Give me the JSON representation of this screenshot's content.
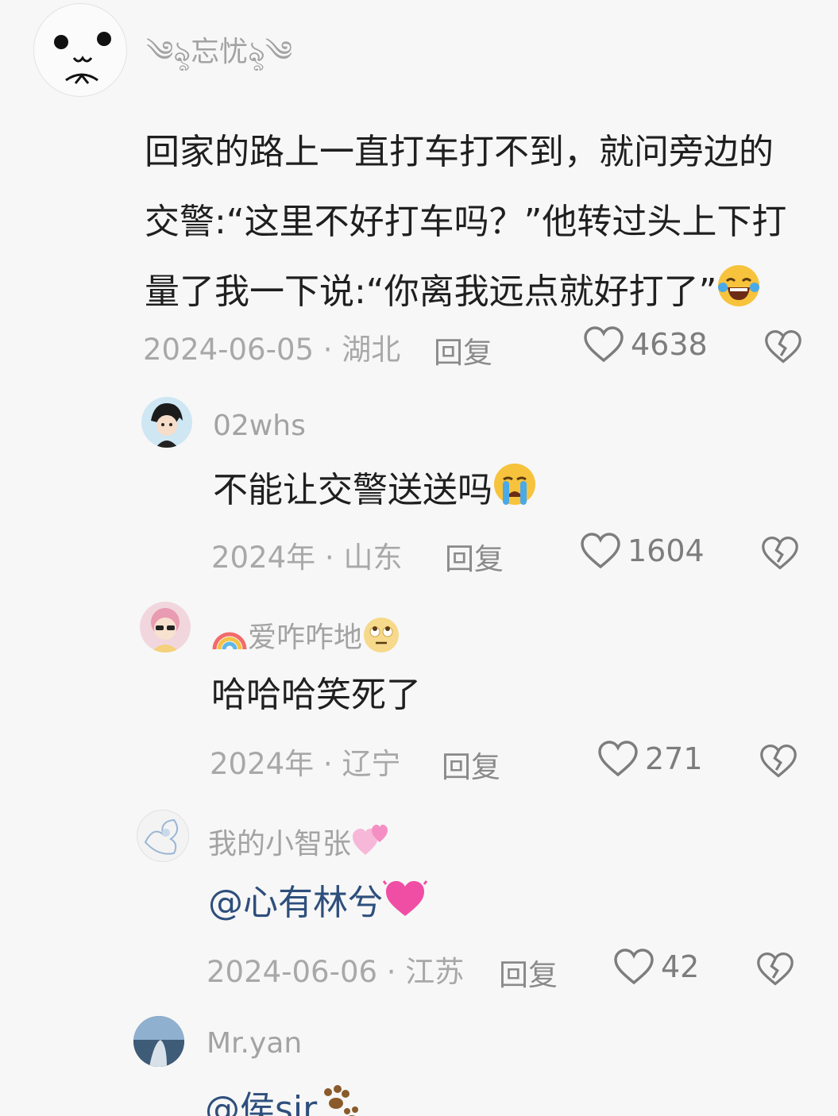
{
  "comments": [
    {
      "username": "忘忧",
      "username_deco_left": "༄ৡ",
      "username_deco_right": "ৡ༄",
      "text_lines": [
        "回家的路上一直打车打不到，就问旁边的",
        "交警:“这里不好打车吗？”他转过头上下打",
        "量了我一下说:“你离我远点就好打了”"
      ],
      "emoji": "laughing-tears",
      "date_location": "2024-06-05 · 湖北",
      "reply_label": "回复",
      "likes": "4638"
    },
    {
      "username": "02whs",
      "text": "不能让交警送送吗",
      "emoji": "crying-face",
      "date_location": "2024年 · 山东",
      "reply_label": "回复",
      "likes": "1604"
    },
    {
      "username": "爱咋咋地",
      "username_prefix_emoji": "rainbow",
      "username_suffix_emoji": "eye-roll-face",
      "text": "哈哈哈笑死了",
      "date_location": "2024年 · 辽宁",
      "reply_label": "回复",
      "likes": "271"
    },
    {
      "username": "我的小智张",
      "username_suffix_emoji": "two-hearts",
      "text_mention": "@心有林兮",
      "emoji": "pink-heart",
      "date_location": "2024-06-06 · 江苏",
      "reply_label": "回复",
      "likes": "42"
    },
    {
      "username": "Mr.yan",
      "text_mention": "@侯sir",
      "emoji": "paw-prints"
    }
  ],
  "colors": {
    "background": "#f7f7f7",
    "text": "#1f1f1f",
    "secondary": "#a8a8a8",
    "mention": "#2e4f7c"
  }
}
